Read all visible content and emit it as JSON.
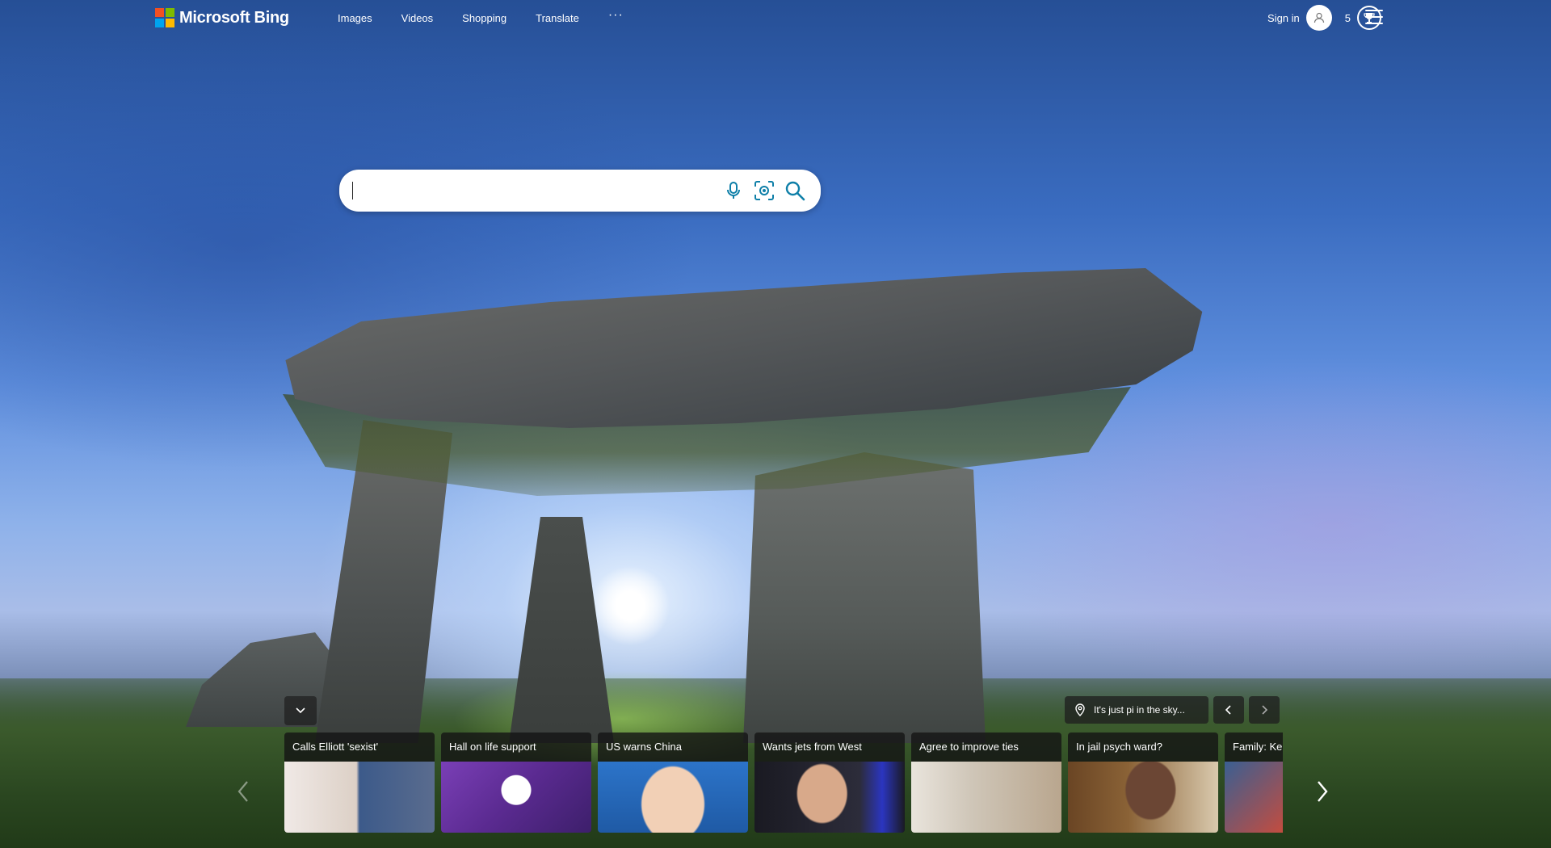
{
  "brand": {
    "name": "Microsoft Bing"
  },
  "nav": {
    "items": [
      "Images",
      "Videos",
      "Shopping",
      "Translate"
    ],
    "more": "···"
  },
  "account": {
    "sign_in": "Sign in",
    "points": "5"
  },
  "search": {
    "value": "",
    "placeholder": ""
  },
  "location": {
    "text": "It's just pi in the sky..."
  },
  "news": {
    "cards": [
      {
        "title": "Calls Elliott 'sexist'"
      },
      {
        "title": "Hall on life support"
      },
      {
        "title": "US warns China"
      },
      {
        "title": "Wants jets from West"
      },
      {
        "title": "Agree to improve ties"
      },
      {
        "title": "In jail psych ward?"
      },
      {
        "title": "Family: Ke"
      }
    ]
  },
  "colors": {
    "bing_accent": "#0e7fa8",
    "ms_red": "#f25022",
    "ms_green": "#7fba00",
    "ms_blue": "#00a4ef",
    "ms_yellow": "#ffb900"
  }
}
